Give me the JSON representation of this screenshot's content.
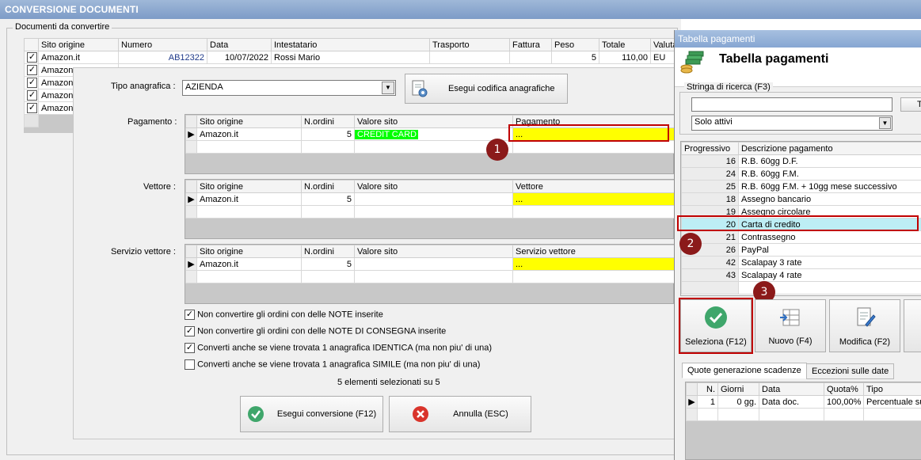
{
  "window": {
    "title": "CONVERSIONE DOCUMENTI"
  },
  "documents": {
    "legend": "Documenti da convertire",
    "columns": [
      "Sito origine",
      "Numero",
      "Data",
      "Intestatario",
      "Trasporto",
      "Fattura",
      "Peso",
      "Totale",
      "Valuta"
    ],
    "rows": [
      {
        "checked": true,
        "sito": "Amazon.it",
        "numero": "AB12322",
        "data": "10/07/2022",
        "intestatario": "Rossi Mario",
        "trasporto": "",
        "fattura": "",
        "peso": "5",
        "totale": "110,00",
        "valuta": "EU"
      },
      {
        "checked": true,
        "sito": "Amazon"
      },
      {
        "checked": true,
        "sito": "Amazon"
      },
      {
        "checked": true,
        "sito": "Amazon"
      },
      {
        "checked": true,
        "sito": "Amazon"
      }
    ]
  },
  "dialog": {
    "tipo_anagrafica_label": "Tipo anagrafica :",
    "tipo_anagrafica_value": "AZIENDA",
    "esegui_codifica_label": "Esegui codifica anagrafiche",
    "pagamento": {
      "label": "Pagamento :",
      "columns": [
        "Sito origine",
        "N.ordini",
        "Valore sito",
        "Pagamento"
      ],
      "row": {
        "sito": "Amazon.it",
        "nordini": "5",
        "valore": "CREDIT CARD",
        "value": "..."
      }
    },
    "vettore": {
      "label": "Vettore :",
      "columns": [
        "Sito origine",
        "N.ordini",
        "Valore sito",
        "Vettore"
      ],
      "row": {
        "sito": "Amazon.it",
        "nordini": "5",
        "valore": "",
        "value": "..."
      }
    },
    "servizio": {
      "label": "Servizio vettore :",
      "columns": [
        "Sito origine",
        "N.ordini",
        "Valore sito",
        "Servizio vettore"
      ],
      "row": {
        "sito": "Amazon.it",
        "nordini": "5",
        "valore": "",
        "value": "..."
      }
    },
    "options": [
      {
        "checked": true,
        "label": "Non convertire gli ordini con delle NOTE inserite"
      },
      {
        "checked": true,
        "label": "Non convertire gli ordini con delle NOTE DI CONSEGNA inserite"
      },
      {
        "checked": true,
        "label": "Converti anche se viene trovata 1 anagrafica IDENTICA (ma non piu' di una)"
      },
      {
        "checked": false,
        "label": "Converti anche se viene trovata 1 anagrafica SIMILE (ma non piu' di una)"
      }
    ],
    "selection_info": "5 elementi selezionati su 5",
    "esegui_conversione": "Esegui conversione (F12)",
    "annulla": "Annulla (ESC)"
  },
  "pagamenti": {
    "window_title": "Tabella pagamenti",
    "header_title": "Tabella pagamenti",
    "search_label": "Stringa di ricerca (F3)",
    "search_value": "",
    "filter_value": "Solo attivi",
    "columns": [
      "Progressivo",
      "Descrizione pagamento"
    ],
    "rows": [
      {
        "prog": "16",
        "desc": "R.B. 60gg D.F."
      },
      {
        "prog": "24",
        "desc": "R.B. 60gg F.M."
      },
      {
        "prog": "25",
        "desc": "R.B. 60gg F.M. + 10gg mese successivo"
      },
      {
        "prog": "18",
        "desc": "Assegno bancario"
      },
      {
        "prog": "19",
        "desc": "Assegno circolare"
      },
      {
        "prog": "20",
        "desc": "Carta di credito"
      },
      {
        "prog": "21",
        "desc": "Contrassegno"
      },
      {
        "prog": "26",
        "desc": "PayPal"
      },
      {
        "prog": "42",
        "desc": "Scalapay 3 rate"
      },
      {
        "prog": "43",
        "desc": "Scalapay 4 rate"
      }
    ],
    "seleziona": "Seleziona (F12)",
    "nuovo": "Nuovo (F4)",
    "modifica": "Modifica (F2)",
    "tabs": [
      "Quote generazione scadenze",
      "Eccezioni sulle date"
    ],
    "quote_columns": [
      "N.",
      "Giorni",
      "Data",
      "Quota%",
      "Tipo"
    ],
    "quote_row": {
      "n": "1",
      "giorni": "0 gg.",
      "data": "Data doc.",
      "quota": "100,00%",
      "tipo": "Percentuale su"
    },
    "side_button_partial": "T"
  },
  "annotations": [
    "1",
    "2",
    "3"
  ],
  "colors": {
    "highlight_yellow": "#ffff00",
    "credit_green": "#00ff00",
    "annotation_red": "#c00000",
    "badge": "#8b1a1a",
    "selected_row": "#bdeef5"
  }
}
